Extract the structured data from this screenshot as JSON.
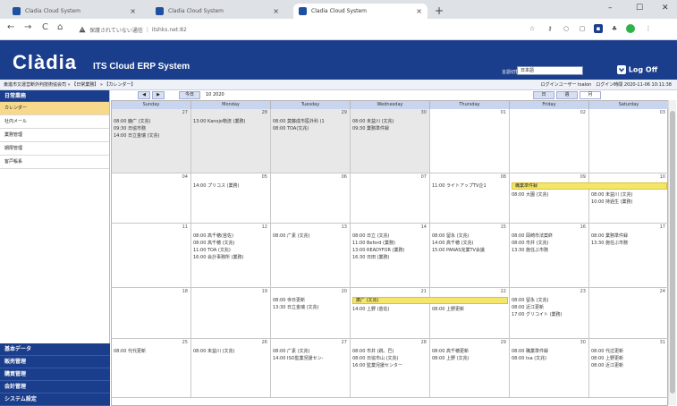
{
  "browser": {
    "tabs": [
      {
        "title": "Cladia Cloud System",
        "close": "×"
      },
      {
        "title": "Cladia Cloud System",
        "close": "×"
      },
      {
        "title": "Cladia Cloud System",
        "close": "×"
      }
    ],
    "new_tab": "+",
    "window": {
      "minimize": "–",
      "maximize": "☐",
      "close": "✕"
    },
    "nav": {
      "back": "←",
      "forward": "→",
      "reload": "C",
      "home": "⌂"
    },
    "address": {
      "security_icon": "warning-triangle",
      "security_text": "保護されていない通信",
      "url": "itshks.net:82"
    }
  },
  "app": {
    "logo": "Clàdia",
    "subtitle": "ITS Cloud ERP System",
    "brand_color": "#1a3e8c",
    "lang_label": "言語切替",
    "lang_value": "日本語",
    "logoff": "Log Off"
  },
  "breadcrumb": {
    "path": "東進市又運営断外判技術協会司 » 【日常業務】 » 【カレンダー】",
    "user": "ログインユーザー tsalon　ログイン時間 2020-11-06 10:11:38"
  },
  "sidebar": {
    "top_group": "日常業務",
    "items": [
      {
        "label": "カレンダー",
        "selected": true
      },
      {
        "label": "社内メール",
        "selected": false
      },
      {
        "label": "業務管理",
        "selected": false
      },
      {
        "label": "期限管理",
        "selected": false
      },
      {
        "label": "客戸帳系",
        "selected": false
      }
    ],
    "bottom_groups": [
      "基本データ",
      "販売管理",
      "購買管理",
      "会計管理",
      "システム設定"
    ]
  },
  "toolbar": {
    "prev": "◀",
    "next": "▶",
    "today": "今日",
    "month_label": "10 2020",
    "view_week": "日",
    "view_day": "週",
    "view_month": "月"
  },
  "calendar": {
    "weekdays": [
      "Sunday",
      "Monday",
      "Tuesday",
      "Wednesday",
      "Thursday",
      "Friday",
      "Saturday"
    ],
    "bars": [
      {
        "label": "職業準件録",
        "week": 1,
        "start": 5,
        "span": 2
      },
      {
        "label": "廣广 (文兆)",
        "week": 3,
        "start": 3,
        "span": 2
      }
    ],
    "weeks": [
      [
        {
          "n": "27",
          "other": true,
          "ev": [
            "08:00 鹿广 (文兆)",
            "09:30 日協市務",
            "14:00 日立金瑞 (文兆)"
          ]
        },
        {
          "n": "28",
          "other": true,
          "ev": [
            "13:00 Kanojo物流 (業務)"
          ]
        },
        {
          "n": "29",
          "other": true,
          "ev": [
            "08:00 莫藤成市医外科 (1",
            "08:00 TOA(文兆)"
          ]
        },
        {
          "n": "30",
          "other": true,
          "ev": [
            "08:00 未益川 (文兆)",
            "09:30 業務準件録"
          ]
        },
        {
          "n": "01",
          "other": false,
          "ev": []
        },
        {
          "n": "02",
          "other": false,
          "ev": []
        },
        {
          "n": "03",
          "other": false,
          "ev": []
        }
      ],
      [
        {
          "n": "04",
          "other": false,
          "ev": []
        },
        {
          "n": "05",
          "other": false,
          "ev": [
            "14:00 プリコス (業務)"
          ]
        },
        {
          "n": "06",
          "other": false,
          "ev": []
        },
        {
          "n": "07",
          "other": false,
          "ev": []
        },
        {
          "n": "08",
          "other": false,
          "ev": [
            "11:00 ライトアップTV企1"
          ]
        },
        {
          "n": "09",
          "other": false,
          "ev": [
            "08:00 大園 (文兆)"
          ]
        },
        {
          "n": "10",
          "other": false,
          "ev": [
            "08:00 未益川 (文兆)",
            "10:00 持過生 (業務)"
          ]
        }
      ],
      [
        {
          "n": "11",
          "other": false,
          "ev": []
        },
        {
          "n": "12",
          "other": false,
          "ev": [
            "08:00 高千穂(苗佐)",
            "08:00 高千穂 (文兆)",
            "11:00 TOA (文兆)",
            "16:00 会計事務所 (業務)"
          ]
        },
        {
          "n": "13",
          "other": false,
          "ev": [
            "08:00 广素 (文兆)"
          ]
        },
        {
          "n": "14",
          "other": false,
          "ev": [
            "08:00 日立 (文兆)",
            "11:00 Beford (業務)",
            "13:00 READYFOR (業務)",
            "16:30 日田 (業務)"
          ]
        },
        {
          "n": "15",
          "other": false,
          "ev": [
            "08:00 留永 (文兆)",
            "14:00 高千穂 (文兆)",
            "15:00 PANAS完業TV会議"
          ]
        },
        {
          "n": "16",
          "other": false,
          "ev": [
            "08:00 岡崎市法案終",
            "08:00 市井 (文兆)",
            "13:30 施任ぶ市務"
          ]
        },
        {
          "n": "17",
          "other": false,
          "ev": [
            "08:00 業務準件録",
            "13:30 施任ぶ市務"
          ]
        }
      ],
      [
        {
          "n": "18",
          "other": false,
          "ev": []
        },
        {
          "n": "19",
          "other": false,
          "ev": []
        },
        {
          "n": "20",
          "other": false,
          "ev": [
            "08:00 寺日更新",
            "13:30 日立金瑞 (文兆)"
          ]
        },
        {
          "n": "21",
          "other": false,
          "ev": [
            "14:00 上野 (苗佐)"
          ]
        },
        {
          "n": "22",
          "other": false,
          "ev": [
            "08:00 上野更新"
          ]
        },
        {
          "n": "23",
          "other": false,
          "ev": [
            "08:00 留永 (文兆)",
            "08:00 近江更新",
            "17:00 グリコイト (業務)"
          ]
        },
        {
          "n": "24",
          "other": false,
          "ev": []
        }
      ],
      [
        {
          "n": "25",
          "other": false,
          "ev": [
            "08:00 代代更新"
          ]
        },
        {
          "n": "26",
          "other": false,
          "ev": [
            "08:00 未益川 (文兆)"
          ]
        },
        {
          "n": "27",
          "other": false,
          "ev": [
            "08:00 广素 (文兆)",
            "14:00 ISO監業児援セン-"
          ]
        },
        {
          "n": "28",
          "other": false,
          "ev": [
            "08:00 市井 (跳、巴)",
            "08:00 日協市山 (文兆)",
            "16:00 監業児援センター"
          ]
        },
        {
          "n": "29",
          "other": false,
          "ev": [
            "08:00 高千穂更新",
            "08:00 上野 (文兆)"
          ]
        },
        {
          "n": "30",
          "other": false,
          "ev": [
            "08:00 職業準件録",
            "08:00 tsa (文兆)"
          ]
        },
        {
          "n": "31",
          "other": false,
          "ev": [
            "08:00 代过更新",
            "08:00 上野更新",
            "08:00 近江更新"
          ]
        }
      ]
    ]
  }
}
